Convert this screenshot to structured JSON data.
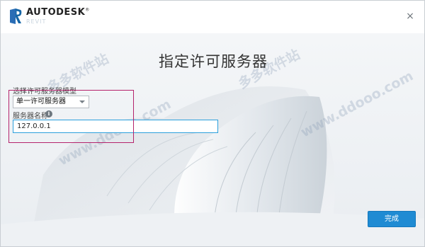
{
  "titlebar": {
    "brand": "AUTODESK",
    "brand_mark": "®",
    "product_sub": "REVIT",
    "close_glyph": "×",
    "logo_icon": "revit-r-logo"
  },
  "dialog": {
    "title": "指定许可服务器",
    "license_type_label": "选择许可服务器模型",
    "license_type_value": "单一许可服务器",
    "server_name_label": "服务器名称",
    "server_name_value": "127.0.0.1",
    "info_glyph": "i",
    "finish_label": "完成"
  },
  "watermarks": {
    "left_cn": "多多软件站",
    "left_url": "www.ddooo.com",
    "right_cn": "多多软件站",
    "right_url": "www.ddooo.com"
  },
  "colors": {
    "accent": "#1f8bd3",
    "highlight": "#b5236c",
    "logo": "#1565a6"
  }
}
